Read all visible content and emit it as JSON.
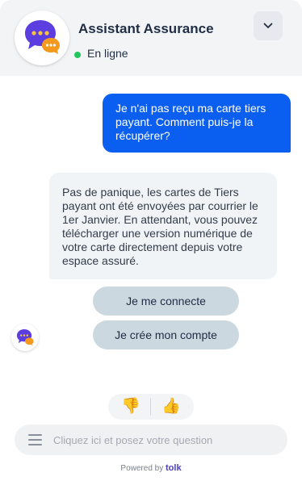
{
  "header": {
    "title": "Assistant Assurance",
    "status": "En ligne",
    "avatar_icon": "chat-bubbles-icon",
    "collapse_icon": "chevron-down-icon"
  },
  "messages": {
    "user": "Je n'ai pas reçu ma carte tiers payant. Comment puis-je la récupérer?",
    "bot": "Pas de panique, les cartes de Tiers payant ont été envoyées par courrier le 1er Janvier. En attendant, vous pouvez télécharger une version numérique de votre carte directement depuis votre espace assuré."
  },
  "quick_replies": [
    {
      "label": "Je me connecte"
    },
    {
      "label": "Je crée mon compte"
    }
  ],
  "feedback": {
    "thumbs_down": "👎",
    "thumbs_up": "👍"
  },
  "input": {
    "placeholder": "Cliquez ici et posez votre question",
    "value": ""
  },
  "footer": {
    "powered_by": "Powered by",
    "brand": "tolk"
  },
  "colors": {
    "accent": "#0b5ff0",
    "header_bg": "#f3f4f6",
    "bot_bubble": "#f0f4f7",
    "quick_reply": "#ccd8df",
    "online": "#22c55e",
    "avatar_purple": "#5b3de0",
    "avatar_orange": "#f39a1e"
  }
}
